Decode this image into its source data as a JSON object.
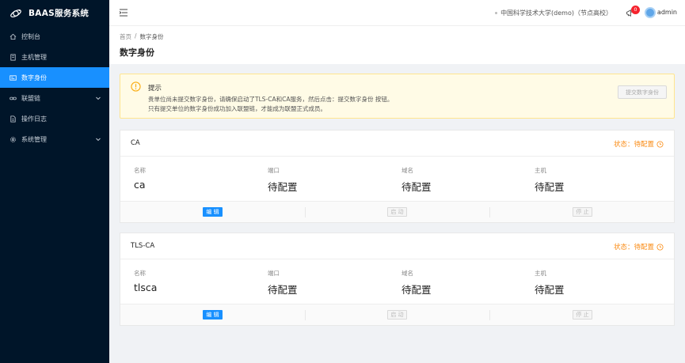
{
  "app": {
    "title": "BAAS服务系统"
  },
  "sidebar": {
    "items": [
      {
        "label": "控制台",
        "icon": "home-icon"
      },
      {
        "label": "主机管理",
        "icon": "server-icon"
      },
      {
        "label": "数字身份",
        "icon": "id-card-icon",
        "active": true
      },
      {
        "label": "联盟链",
        "icon": "chain-icon",
        "has_arrow": true
      },
      {
        "label": "操作日志",
        "icon": "log-icon"
      },
      {
        "label": "系统管理",
        "icon": "gear-icon",
        "has_arrow": true
      }
    ]
  },
  "header": {
    "org": "中国科学技术大学(demo)（节点高校）",
    "badge_count": "0",
    "user": "admin"
  },
  "breadcrumb": {
    "home": "首页",
    "sep": "/",
    "current": "数字身份"
  },
  "page_title": "数字身份",
  "alert": {
    "title": "提示",
    "line1": "贵单位尚未提交数字身份，请确保启动了TLS-CA和CA服务，然后点击：提交数字身份 按钮。",
    "line2": "只有提交单位的数字身份成功加入联盟链，才能成为联盟正式成员。",
    "submit_label": "提交数字身份"
  },
  "cards": [
    {
      "name": "CA",
      "status": "状态：待配置",
      "fields": [
        {
          "label": "名称",
          "value": "ca"
        },
        {
          "label": "端口",
          "value": "待配置"
        },
        {
          "label": "域名",
          "value": "待配置"
        },
        {
          "label": "主机",
          "value": "待配置"
        }
      ],
      "actions": {
        "edit": "编 辑",
        "start": "启 动",
        "stop": "停 止"
      }
    },
    {
      "name": "TLS-CA",
      "status": "状态：待配置",
      "fields": [
        {
          "label": "名称",
          "value": "tlsca"
        },
        {
          "label": "端口",
          "value": "待配置"
        },
        {
          "label": "域名",
          "value": "待配置"
        },
        {
          "label": "主机",
          "value": "待配置"
        }
      ],
      "actions": {
        "edit": "编 辑",
        "start": "启 动",
        "stop": "停 止"
      }
    }
  ],
  "colors": {
    "sidebar_bg": "#001529",
    "accent": "#1890ff",
    "warning": "#fa8c16",
    "badge": "#f5222d"
  }
}
